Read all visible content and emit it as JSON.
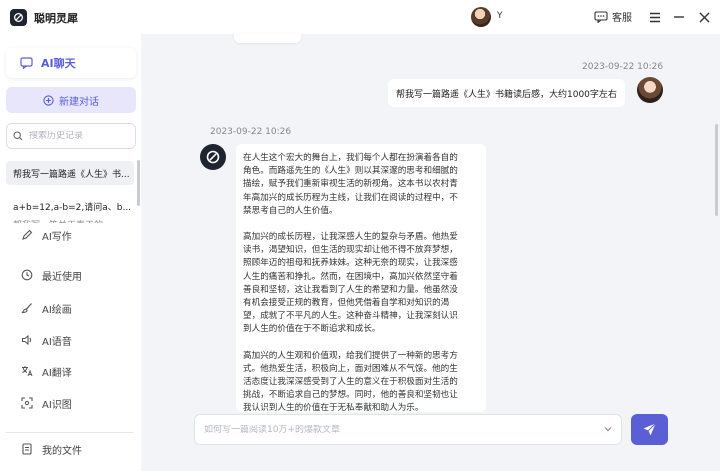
{
  "app": {
    "name": "聪明灵犀"
  },
  "user": {
    "name": "Y"
  },
  "titlebar": {
    "service_label": "客服"
  },
  "sidebar": {
    "chat_label": "AI聊天",
    "new_chat_label": "新建对话",
    "search_placeholder": "搜索历史记录",
    "history": [
      "帮我写一篇路遥《人生》书...",
      "a+b=12,a-b=2,请问a、b...",
      "帮我写一篇关于春天的..."
    ],
    "menu": [
      {
        "label": "AI写作",
        "icon": "pen-icon"
      },
      {
        "label": "最近使用",
        "icon": "clock-icon"
      },
      {
        "label": "AI绘画",
        "icon": "brush-icon"
      },
      {
        "label": "AI语音",
        "icon": "speaker-icon"
      },
      {
        "label": "AI翻译",
        "icon": "translate-icon"
      },
      {
        "label": "AI识图",
        "icon": "image-scan-icon"
      },
      {
        "label": "我的文件",
        "icon": "file-icon"
      }
    ]
  },
  "conversation": {
    "user_time": "2023-09-22 10:26",
    "user_message": "帮我写一篇路遥《人生》书籍读后感，大约1000字左右",
    "bot_time": "2023-09-22 10:26",
    "bot_paragraphs": [
      "在人生这个宏大的舞台上，我们每个人都在扮演着各自的\n角色。而路遥先生的《人生》则以其深邃的思考和细腻的\n描绘，赋予我们重新审视生活的新视角。这本书以农村青\n年高加兴的成长历程为主线，让我们在阅读的过程中，不\n禁思考自己的人生价值。",
      "高加兴的成长历程，让我深感人生的复杂与矛盾。他热爱\n读书，渴望知识，但生活的现实却让他不得不放弃梦想，\n照顾年迈的祖母和抚养妹妹。这种无奈的现实，让我深感\n人生的痛苦和挣扎。然而，在困境中，高加兴依然坚守着\n善良和坚韧，这让我看到了人生的希望和力量。他虽然没\n有机会接受正规的教育，但他凭借着自学和对知识的渴\n望，成就了不平凡的人生。这种奋斗精神，让我深刻认识\n到人生的价值在于不断追求和成长。",
      "高加兴的人生观和价值观，给我们提供了一种新的思考方\n式。他热爱生活，积极向上，面对困难从不气馁。他的生\n活态度让我深深感受到了人生的意义在于积极面对生活的\n挑战，不断追求自己的梦想。同时，他的善良和坚韧也让\n我认识到人生的价值在于无私奉献和助人为乐。"
    ]
  },
  "composer": {
    "placeholder": "如何写一篇阅读10万+的爆款文章"
  },
  "colors": {
    "accent": "#5b5fd6",
    "accent_light": "#e7e6fb",
    "logo_dark": "#1e2430"
  }
}
